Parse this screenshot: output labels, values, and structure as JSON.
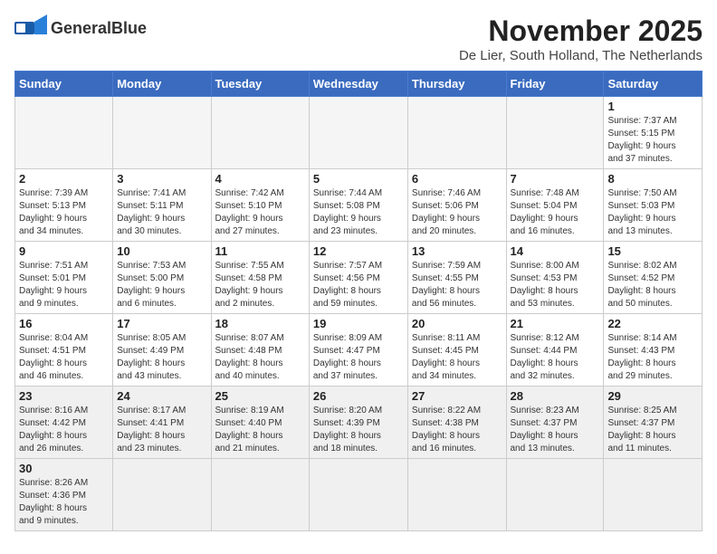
{
  "header": {
    "logo_text_normal": "General",
    "logo_text_bold": "Blue",
    "month": "November 2025",
    "location": "De Lier, South Holland, The Netherlands"
  },
  "weekdays": [
    "Sunday",
    "Monday",
    "Tuesday",
    "Wednesday",
    "Thursday",
    "Friday",
    "Saturday"
  ],
  "days": [
    {
      "date": "",
      "info": ""
    },
    {
      "date": "",
      "info": ""
    },
    {
      "date": "",
      "info": ""
    },
    {
      "date": "",
      "info": ""
    },
    {
      "date": "",
      "info": ""
    },
    {
      "date": "",
      "info": ""
    },
    {
      "date": "1",
      "info": "Sunrise: 7:37 AM\nSunset: 5:15 PM\nDaylight: 9 hours\nand 37 minutes."
    },
    {
      "date": "2",
      "info": "Sunrise: 7:39 AM\nSunset: 5:13 PM\nDaylight: 9 hours\nand 34 minutes."
    },
    {
      "date": "3",
      "info": "Sunrise: 7:41 AM\nSunset: 5:11 PM\nDaylight: 9 hours\nand 30 minutes."
    },
    {
      "date": "4",
      "info": "Sunrise: 7:42 AM\nSunset: 5:10 PM\nDaylight: 9 hours\nand 27 minutes."
    },
    {
      "date": "5",
      "info": "Sunrise: 7:44 AM\nSunset: 5:08 PM\nDaylight: 9 hours\nand 23 minutes."
    },
    {
      "date": "6",
      "info": "Sunrise: 7:46 AM\nSunset: 5:06 PM\nDaylight: 9 hours\nand 20 minutes."
    },
    {
      "date": "7",
      "info": "Sunrise: 7:48 AM\nSunset: 5:04 PM\nDaylight: 9 hours\nand 16 minutes."
    },
    {
      "date": "8",
      "info": "Sunrise: 7:50 AM\nSunset: 5:03 PM\nDaylight: 9 hours\nand 13 minutes."
    },
    {
      "date": "9",
      "info": "Sunrise: 7:51 AM\nSunset: 5:01 PM\nDaylight: 9 hours\nand 9 minutes."
    },
    {
      "date": "10",
      "info": "Sunrise: 7:53 AM\nSunset: 5:00 PM\nDaylight: 9 hours\nand 6 minutes."
    },
    {
      "date": "11",
      "info": "Sunrise: 7:55 AM\nSunset: 4:58 PM\nDaylight: 9 hours\nand 2 minutes."
    },
    {
      "date": "12",
      "info": "Sunrise: 7:57 AM\nSunset: 4:56 PM\nDaylight: 8 hours\nand 59 minutes."
    },
    {
      "date": "13",
      "info": "Sunrise: 7:59 AM\nSunset: 4:55 PM\nDaylight: 8 hours\nand 56 minutes."
    },
    {
      "date": "14",
      "info": "Sunrise: 8:00 AM\nSunset: 4:53 PM\nDaylight: 8 hours\nand 53 minutes."
    },
    {
      "date": "15",
      "info": "Sunrise: 8:02 AM\nSunset: 4:52 PM\nDaylight: 8 hours\nand 50 minutes."
    },
    {
      "date": "16",
      "info": "Sunrise: 8:04 AM\nSunset: 4:51 PM\nDaylight: 8 hours\nand 46 minutes."
    },
    {
      "date": "17",
      "info": "Sunrise: 8:05 AM\nSunset: 4:49 PM\nDaylight: 8 hours\nand 43 minutes."
    },
    {
      "date": "18",
      "info": "Sunrise: 8:07 AM\nSunset: 4:48 PM\nDaylight: 8 hours\nand 40 minutes."
    },
    {
      "date": "19",
      "info": "Sunrise: 8:09 AM\nSunset: 4:47 PM\nDaylight: 8 hours\nand 37 minutes."
    },
    {
      "date": "20",
      "info": "Sunrise: 8:11 AM\nSunset: 4:45 PM\nDaylight: 8 hours\nand 34 minutes."
    },
    {
      "date": "21",
      "info": "Sunrise: 8:12 AM\nSunset: 4:44 PM\nDaylight: 8 hours\nand 32 minutes."
    },
    {
      "date": "22",
      "info": "Sunrise: 8:14 AM\nSunset: 4:43 PM\nDaylight: 8 hours\nand 29 minutes."
    },
    {
      "date": "23",
      "info": "Sunrise: 8:16 AM\nSunset: 4:42 PM\nDaylight: 8 hours\nand 26 minutes."
    },
    {
      "date": "24",
      "info": "Sunrise: 8:17 AM\nSunset: 4:41 PM\nDaylight: 8 hours\nand 23 minutes."
    },
    {
      "date": "25",
      "info": "Sunrise: 8:19 AM\nSunset: 4:40 PM\nDaylight: 8 hours\nand 21 minutes."
    },
    {
      "date": "26",
      "info": "Sunrise: 8:20 AM\nSunset: 4:39 PM\nDaylight: 8 hours\nand 18 minutes."
    },
    {
      "date": "27",
      "info": "Sunrise: 8:22 AM\nSunset: 4:38 PM\nDaylight: 8 hours\nand 16 minutes."
    },
    {
      "date": "28",
      "info": "Sunrise: 8:23 AM\nSunset: 4:37 PM\nDaylight: 8 hours\nand 13 minutes."
    },
    {
      "date": "29",
      "info": "Sunrise: 8:25 AM\nSunset: 4:37 PM\nDaylight: 8 hours\nand 11 minutes."
    },
    {
      "date": "30",
      "info": "Sunrise: 8:26 AM\nSunset: 4:36 PM\nDaylight: 8 hours\nand 9 minutes."
    },
    {
      "date": "",
      "info": ""
    },
    {
      "date": "",
      "info": ""
    },
    {
      "date": "",
      "info": ""
    },
    {
      "date": "",
      "info": ""
    },
    {
      "date": "",
      "info": ""
    },
    {
      "date": "",
      "info": ""
    }
  ]
}
